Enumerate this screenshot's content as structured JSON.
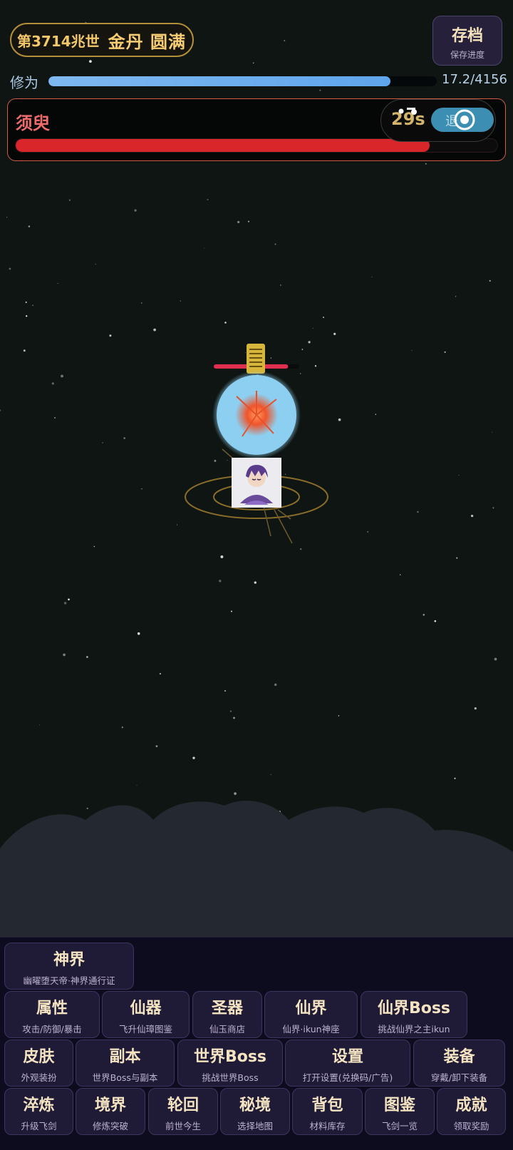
{
  "header": {
    "era": "第3714兆世",
    "stage": "金丹 圆满",
    "save_button": {
      "title": "存档",
      "subtitle": "保存进度"
    }
  },
  "cultivation": {
    "label": "修为",
    "value_text": "17.2/4156",
    "progress": 0.88
  },
  "boss": {
    "name": "须臾",
    "hp_fraction": 0.86,
    "timer": "29s",
    "retreat_label": "退"
  },
  "battle": {
    "enemy_hp_fraction": 0.87,
    "enemy_label": "金色字符"
  },
  "menu": {
    "shenjie": {
      "title": "神界",
      "subtitle": "幽曜堕天帝·神界通行证"
    },
    "row1": [
      {
        "title": "属性",
        "subtitle": "攻击/防御/暴击"
      },
      {
        "title": "仙器",
        "subtitle": "飞升仙璋图鉴"
      },
      {
        "title": "圣器",
        "subtitle": "仙玉商店"
      },
      {
        "title": "仙界",
        "subtitle": "仙界·ikun神座"
      },
      {
        "title": "仙界Boss",
        "subtitle": "挑战仙界之主ikun"
      }
    ],
    "row2": [
      {
        "title": "皮肤",
        "subtitle": "外观装扮"
      },
      {
        "title": "副本",
        "subtitle": "世界Boss与副本"
      },
      {
        "title": "世界Boss",
        "subtitle": "挑战世界Boss"
      },
      {
        "title": "设置",
        "subtitle": "打开设置(兑换码/广告)"
      },
      {
        "title": "装备",
        "subtitle": "穿戴/卸下装备"
      }
    ],
    "row3": [
      {
        "title": "淬炼",
        "subtitle": "升级飞剑"
      },
      {
        "title": "境界",
        "subtitle": "修炼突破"
      },
      {
        "title": "轮回",
        "subtitle": "前世今生"
      },
      {
        "title": "秘境",
        "subtitle": "选择地图"
      },
      {
        "title": "背包",
        "subtitle": "材料库存"
      },
      {
        "title": "图鉴",
        "subtitle": "飞剑一览"
      },
      {
        "title": "成就",
        "subtitle": "领取奖励"
      }
    ]
  },
  "colors": {
    "background": "#0f1512",
    "gold": "#f3c86a",
    "boss_red": "#d8262a",
    "cultivation_blue": "#6aaeee",
    "button_bg": "#1f1a36"
  }
}
